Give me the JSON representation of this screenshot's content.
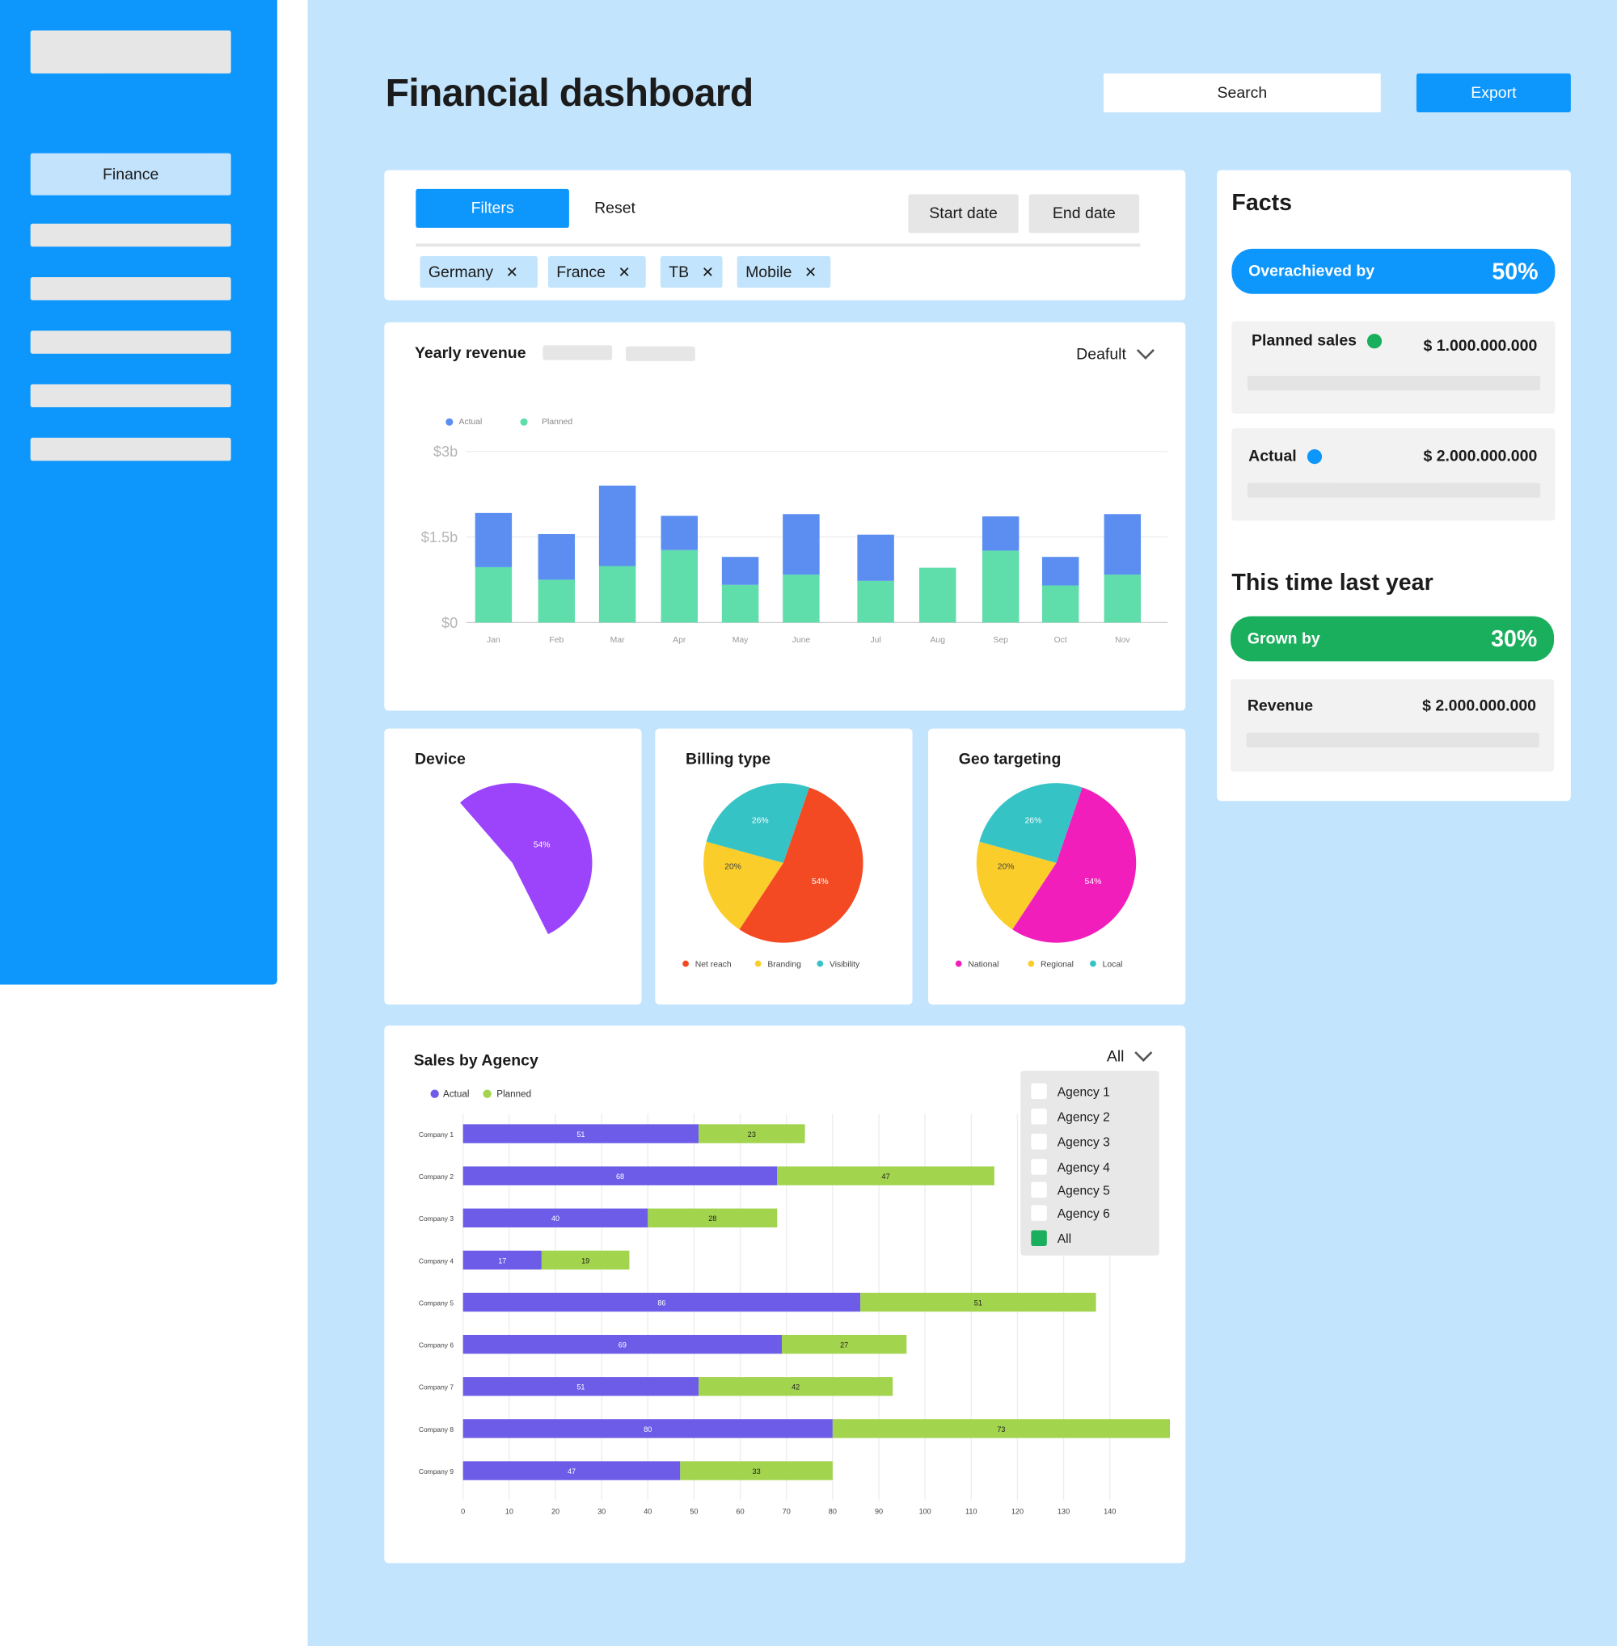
{
  "sidebar": {
    "active_item": "Finance"
  },
  "header": {
    "title": "Financial dashboard",
    "search_placeholder": "Search",
    "export_label": "Export"
  },
  "filters": {
    "filters_label": "Filters",
    "reset_label": "Reset",
    "start_date_label": "Start date",
    "end_date_label": "End date",
    "chips": [
      "Germany",
      "France",
      "TB",
      "Mobile"
    ]
  },
  "yearly_revenue": {
    "title": "Yearly revenue",
    "dropdown_label": "Deafult",
    "legend": [
      "Actual",
      "Planned"
    ],
    "y_ticks": [
      "$3b",
      "$1.5b",
      "$0"
    ]
  },
  "device": {
    "title": "Device",
    "slice_label": "54%"
  },
  "billing": {
    "title": "Billing type",
    "legend": [
      "Net reach",
      "Branding",
      "Visibility"
    ],
    "labels": [
      "54%",
      "20%",
      "26%"
    ]
  },
  "geo": {
    "title": "Geo targeting",
    "legend": [
      "National",
      "Regional",
      "Local"
    ],
    "labels": [
      "54%",
      "20%",
      "26%"
    ]
  },
  "agency": {
    "title": "Sales by Agency",
    "dropdown_label": "All",
    "legend": [
      "Actual",
      "Planned"
    ],
    "options": [
      "Agency 1",
      "Agency 2",
      "Agency 3",
      "Agency 4",
      "Agency 5",
      "Agency 6",
      "All"
    ],
    "selected_option": "All"
  },
  "facts": {
    "title": "Facts",
    "overachieved_label": "Overachieved by",
    "overachieved_value": "50%",
    "planned_label": "Planned sales",
    "planned_value": "$ 1.000.000.000",
    "actual_label": "Actual",
    "actual_value": "$ 2.000.000.000",
    "last_year_title": "This time last year",
    "grown_label": "Grown by",
    "grown_value": "30%",
    "revenue_label": "Revenue",
    "revenue_value": "$ 2.000.000.000"
  },
  "colors": {
    "primary": "#0d96fc",
    "page_bg": "#c2e4fc",
    "actual_blue": "#5b8ef0",
    "planned_green": "#5fddab",
    "agency_actual": "#6c5ce7",
    "agency_planned": "#a2d44e",
    "success": "#1aaf5d",
    "device_purple": "#9b44fc",
    "net_reach": "#f34a23",
    "branding": "#fbcd2b",
    "visibility": "#36c3c6",
    "national": "#f21ebc"
  },
  "chart_data": [
    {
      "type": "bar",
      "title": "Yearly revenue",
      "stacked": true,
      "categories": [
        "Jan",
        "Feb",
        "Mar",
        "Apr",
        "May",
        "June",
        "Jul",
        "Aug",
        "Sep",
        "Oct",
        "Nov"
      ],
      "series": [
        {
          "name": "Planned",
          "values": [
            0.97,
            0.75,
            0.99,
            1.27,
            0.66,
            0.84,
            0.73,
            0.96,
            1.26,
            0.65,
            0.84
          ]
        },
        {
          "name": "Actual",
          "values": [
            0.95,
            0.8,
            1.41,
            0.6,
            0.49,
            1.06,
            0.81,
            0.0,
            0.6,
            0.5,
            1.06
          ]
        }
      ],
      "y_unit": "$b",
      "ylim": [
        0,
        3
      ],
      "y_ticks": [
        "$3b",
        "$1.5b",
        "$0"
      ],
      "grid": true,
      "legend_position": "top-left"
    },
    {
      "type": "pie",
      "title": "Device",
      "slices": [
        {
          "label": "54%",
          "value": 54
        }
      ]
    },
    {
      "type": "pie",
      "title": "Billing type",
      "slices": [
        {
          "name": "Net reach",
          "value": 54
        },
        {
          "name": "Branding",
          "value": 20
        },
        {
          "name": "Visibility",
          "value": 26
        }
      ],
      "legend_position": "bottom"
    },
    {
      "type": "pie",
      "title": "Geo targeting",
      "slices": [
        {
          "name": "National",
          "value": 54
        },
        {
          "name": "Regional",
          "value": 20
        },
        {
          "name": "Local",
          "value": 26
        }
      ],
      "legend_position": "bottom"
    },
    {
      "type": "bar",
      "title": "Sales by Agency",
      "orientation": "horizontal",
      "stacked": true,
      "categories": [
        "Company 1",
        "Company 2",
        "Company 3",
        "Company 4",
        "Company 5",
        "Company 6",
        "Company 7",
        "Company 8",
        "Company 9"
      ],
      "series": [
        {
          "name": "Actual",
          "values": [
            51,
            68,
            40,
            17,
            86,
            69,
            51,
            80,
            47
          ]
        },
        {
          "name": "Planned",
          "values": [
            23,
            47,
            28,
            19,
            51,
            27,
            42,
            73,
            33
          ]
        }
      ],
      "xlim": [
        0,
        140
      ],
      "x_ticks": [
        0,
        10,
        20,
        30,
        40,
        50,
        60,
        70,
        80,
        90,
        100,
        110,
        120,
        130,
        140
      ],
      "grid": true,
      "legend_position": "top-left"
    }
  ]
}
